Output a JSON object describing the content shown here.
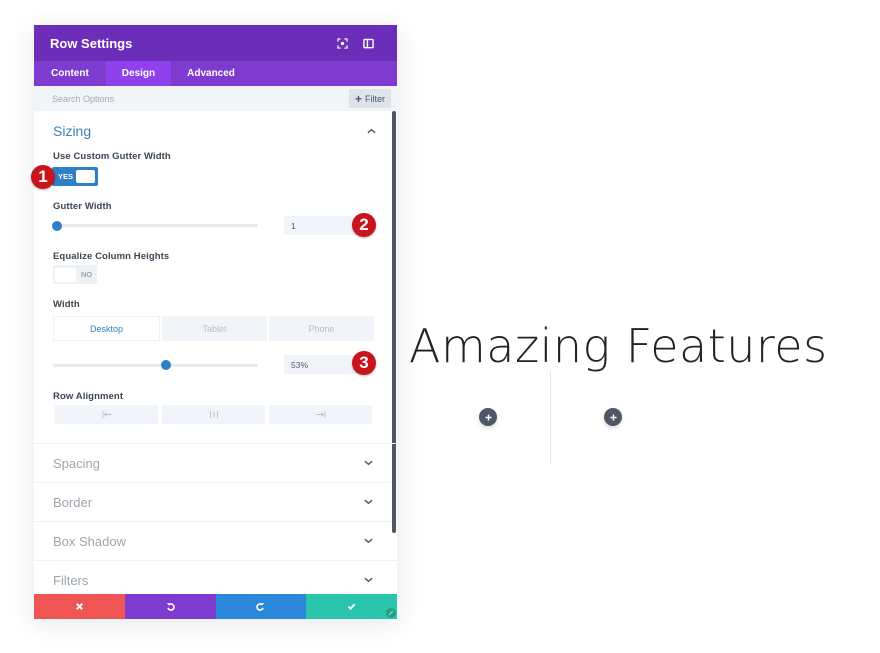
{
  "panel": {
    "title": "Row Settings",
    "header_icons": [
      "focus-icon",
      "sidebar-icon"
    ],
    "tabs": [
      {
        "label": "Content",
        "active": false
      },
      {
        "label": "Design",
        "active": true
      },
      {
        "label": "Advanced",
        "active": false
      }
    ],
    "search": {
      "placeholder": "Search Options",
      "value": ""
    },
    "filter_label": "Filter",
    "sizing": {
      "title": "Sizing",
      "use_custom_gutter": {
        "label": "Use Custom Gutter Width",
        "state": "YES"
      },
      "gutter_width": {
        "label": "Gutter Width",
        "value": "1",
        "slider_fraction": 0.0
      },
      "equalize_heights": {
        "label": "Equalize Column Heights",
        "state": "NO"
      },
      "width": {
        "label": "Width",
        "devices": [
          {
            "label": "Desktop",
            "active": true
          },
          {
            "label": "Tablet",
            "active": false
          },
          {
            "label": "Phone",
            "active": false
          }
        ],
        "value": "53%",
        "slider_fraction": 0.53
      },
      "row_alignment": {
        "label": "Row Alignment",
        "options": [
          "left",
          "center",
          "right"
        ]
      }
    },
    "collapsed_sections": [
      "Spacing",
      "Border",
      "Box Shadow",
      "Filters"
    ],
    "badges": [
      "1",
      "2",
      "3"
    ],
    "footer": {
      "buttons": [
        {
          "name": "cancel",
          "icon": "close-icon",
          "color": "#ef5555"
        },
        {
          "name": "undo",
          "icon": "undo-icon",
          "color": "#7e3bd0"
        },
        {
          "name": "redo",
          "icon": "redo-icon",
          "color": "#2b87da"
        },
        {
          "name": "save",
          "icon": "check-icon",
          "color": "#29c4a9"
        }
      ]
    }
  },
  "canvas": {
    "heading": "Amazing Features",
    "columns": 2
  },
  "colors": {
    "header_purple": "#6c2eb9",
    "tab_purple": "#7e3bd0",
    "active_tab": "#8f42ec",
    "accent_blue": "#2e7fc6",
    "badge_red": "#c8141c"
  }
}
